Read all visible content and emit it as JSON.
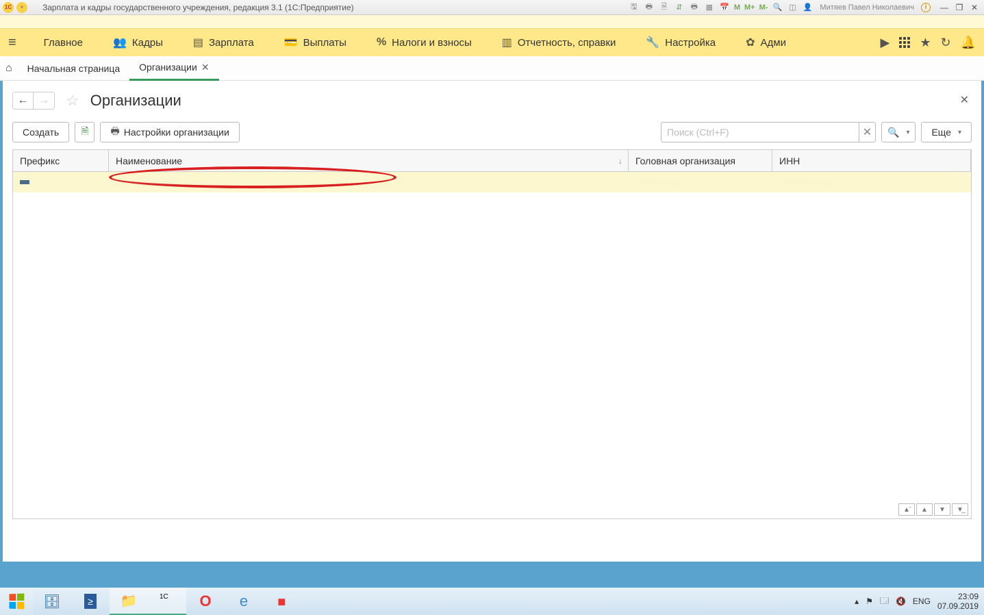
{
  "titlebar": {
    "app_title": "Зарплата и кадры государственного учреждения, редакция 3.1  (1С:Предприятие)",
    "user": "Митяев Павел Николаевич",
    "icons": {
      "m": "M",
      "m_plus": "M+",
      "m_minus": "M-"
    }
  },
  "mainnav": {
    "items": [
      {
        "label": "Главное",
        "icon": ""
      },
      {
        "label": "Кадры",
        "icon": "👥"
      },
      {
        "label": "Зарплата",
        "icon": "▤"
      },
      {
        "label": "Выплаты",
        "icon": "💳"
      },
      {
        "label": "Налоги и взносы",
        "icon": "%"
      },
      {
        "label": "Отчетность, справки",
        "icon": "▥"
      },
      {
        "label": "Настройка",
        "icon": "🔧"
      },
      {
        "label": "Адми",
        "icon": "⚙"
      }
    ]
  },
  "tabs": {
    "home": "Начальная страница",
    "active": "Организации"
  },
  "page": {
    "title": "Организации"
  },
  "toolbar": {
    "create": "Создать",
    "settings": "Настройки организации",
    "search_placeholder": "Поиск (Ctrl+F)",
    "more": "Еще"
  },
  "table": {
    "headers": {
      "prefix": "Префикс",
      "name": "Наименование",
      "head_org": "Головная организация",
      "inn": "ИНН"
    },
    "rows": [
      {
        "prefix": "",
        "name": "····················",
        "head_org": "··············",
        "inn": "·················"
      }
    ]
  },
  "taskbar": {
    "lang": "ENG",
    "time": "23:09",
    "date": "07.09.2019"
  }
}
